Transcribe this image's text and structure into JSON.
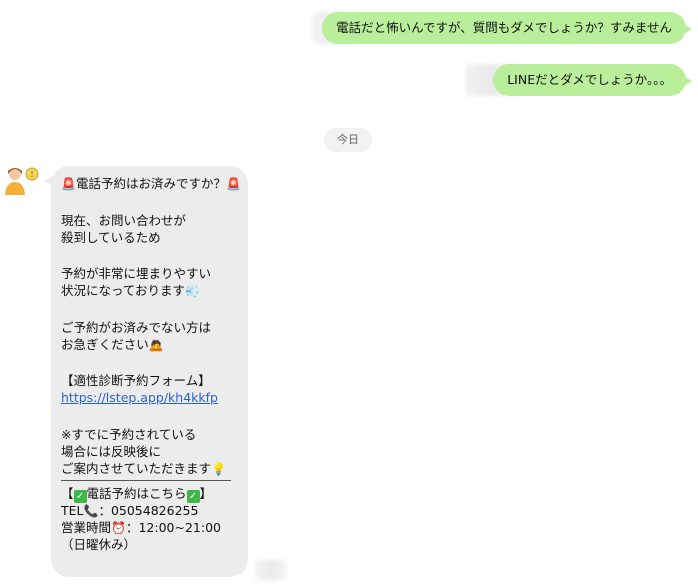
{
  "messages_out": [
    {
      "text": "電話だと怖いんですが、質問もダメでしょうか？すみません"
    },
    {
      "text": "LINEだとダメでしょうか。。。"
    }
  ],
  "date_separator": "今日",
  "message_in": {
    "line1": "電話予約はお済みですか？",
    "para1": [
      "現在、お問い合わせが",
      "殺到しているため"
    ],
    "para2_line1": "予約が非常に埋まりやすい",
    "para2_line2": "状況になっております",
    "para3_line1": "ご予約がお済みでない方は",
    "para3_line2": "お急ぎください",
    "form_title": "【適性診断予約フォーム】",
    "form_link": "https://lstep.app/kh4kkfp",
    "para4_line1": "※すでに予約されている",
    "para4_line2": "場合には反映後に",
    "para4_line3": "ご案内させていただきます",
    "phone_heading": "電話予約はこちら",
    "tel_label": "TEL",
    "tel_number": "：05054826255",
    "hours_label": "営業時間",
    "hours_value": "：12:00~21:00",
    "closed": "（日曜休み）"
  },
  "icons": {
    "siren": "siren-icon",
    "check": "check-icon",
    "phone": "phone-icon",
    "clock": "alarm-clock-icon",
    "bulb": "lightbulb-icon"
  },
  "colors": {
    "outgoing_bubble": "#b9ee9a",
    "incoming_bubble": "#ececec",
    "link": "#2a63c9"
  }
}
